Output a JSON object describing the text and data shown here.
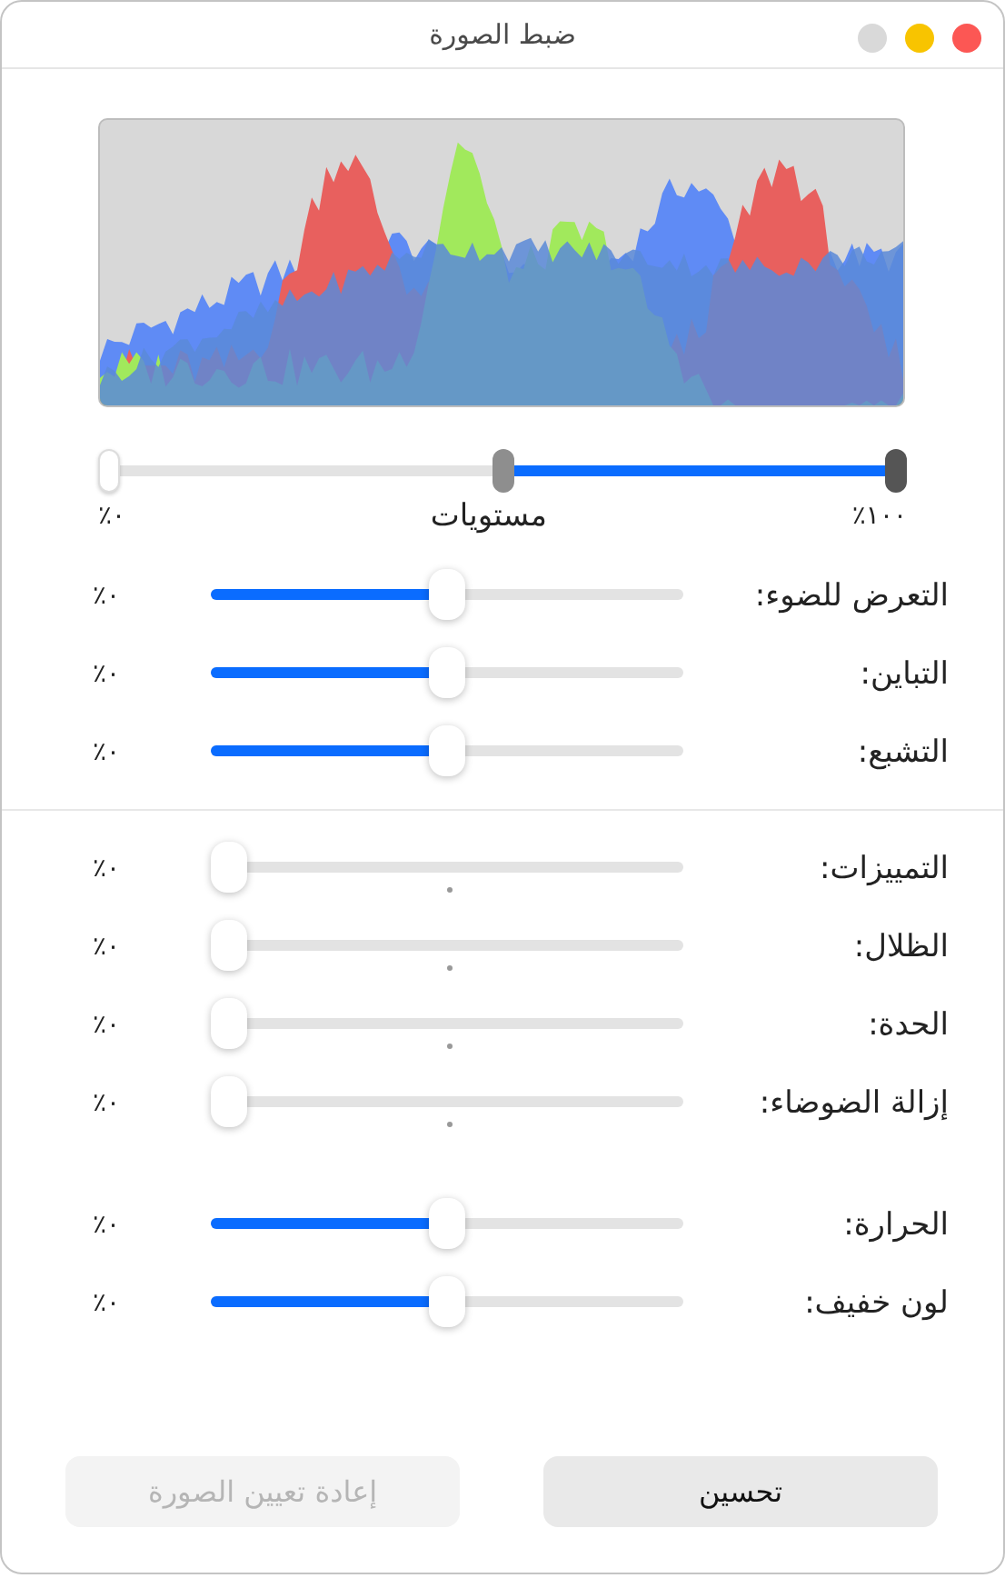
{
  "window": {
    "title": "ضبط الصورة"
  },
  "levels": {
    "label": "مستويات",
    "min_label": "٪٠",
    "max_label": "٪١٠٠",
    "thumbs": [
      {
        "level": 0
      },
      {
        "level": 0.5
      },
      {
        "level": 1
      }
    ]
  },
  "groups": [
    {
      "sliders": [
        {
          "label": "التعرض للضوء:",
          "kind": "filled",
          "level": 0.5,
          "reading": "٪٠"
        },
        {
          "label": "التباين:",
          "kind": "filled",
          "level": 0.5,
          "reading": "٪٠"
        },
        {
          "label": "التشبع:",
          "kind": "filled",
          "level": 0.5,
          "reading": "٪٠"
        }
      ]
    },
    {
      "sliders": [
        {
          "label": "التمييزات:",
          "kind": "ticked",
          "level": 0,
          "reading": "٪٠"
        },
        {
          "label": "الظلال:",
          "kind": "ticked",
          "level": 0,
          "reading": "٪٠"
        },
        {
          "label": "الحدة:",
          "kind": "ticked",
          "level": 0,
          "reading": "٪٠"
        },
        {
          "label": "إزالة الضوضاء:",
          "kind": "ticked",
          "level": 0,
          "reading": "٪٠"
        }
      ]
    },
    {
      "sliders": [
        {
          "label": "الحرارة:",
          "kind": "filled",
          "level": 0.5,
          "reading": "٪٠"
        },
        {
          "label": "لون خفيف:",
          "kind": "filled",
          "level": 0.5,
          "reading": "٪٠"
        }
      ]
    }
  ],
  "buttons": [
    {
      "label": "تحسين",
      "disabled": false
    },
    {
      "label": "إعادة تعيين الصورة",
      "disabled": true
    }
  ]
}
